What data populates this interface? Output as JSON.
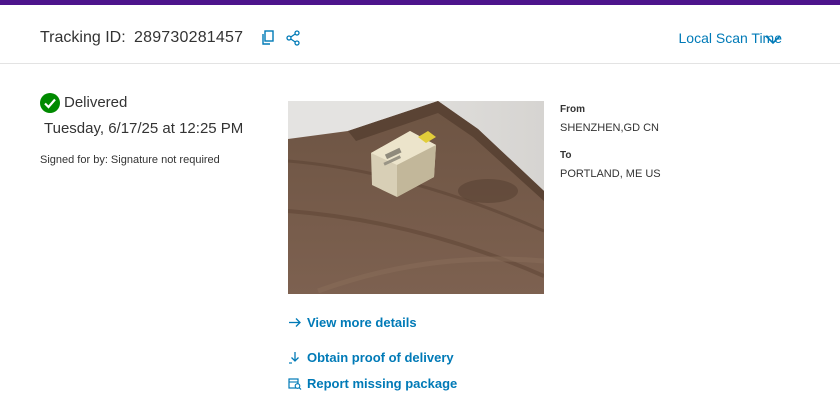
{
  "header": {
    "tracking_label": "Tracking ID:",
    "tracking_id": "289730281457",
    "scan_time_label": "Local Scan Time",
    "icons": [
      "copy-icon",
      "share-icon",
      "chevron-down-icon"
    ]
  },
  "status": {
    "label": "Delivered",
    "icon": "check-circle-icon",
    "date": "Tuesday, 6/17/25 at 12:25 PM",
    "signed_for": "Signed for by: Signature not required"
  },
  "shipment": {
    "from_label": "From",
    "from_value": "SHENZHEN,GD CN",
    "to_label": "To",
    "to_value": "PORTLAND, ME US"
  },
  "links": {
    "view_details": "View more details",
    "proof_of_delivery": "Obtain proof of delivery",
    "report_missing": "Report missing package"
  },
  "colors": {
    "brand_purple": "#4d148c",
    "link_blue": "#007ab7",
    "success_green": "#008a00"
  }
}
